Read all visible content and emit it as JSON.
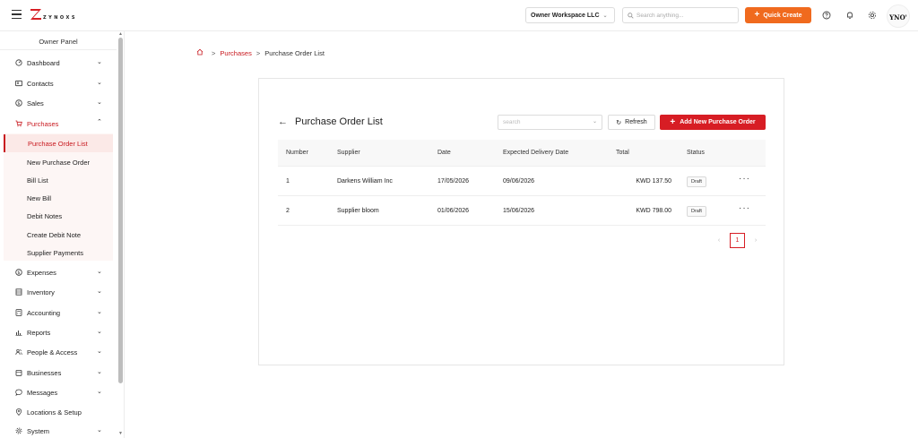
{
  "app": {
    "logo_text": "ZYNOXS",
    "brand_color": "#d71d24",
    "accent_color": "#f06a1e"
  },
  "topbar": {
    "workspace": "Owner Workspace LLC",
    "search_placeholder": "Search anything...",
    "quick_create": "Quick Create",
    "avatar_text": "YNO'"
  },
  "sidebar": {
    "panel_title": "Owner Panel",
    "items": [
      {
        "label": "Dashboard",
        "icon": "dashboard-icon"
      },
      {
        "label": "Contacts",
        "icon": "contacts-icon"
      },
      {
        "label": "Sales",
        "icon": "dollar-icon"
      },
      {
        "label": "Purchases",
        "icon": "cart-icon",
        "expanded": true
      },
      {
        "label": "Expenses",
        "icon": "dollar-icon"
      },
      {
        "label": "Inventory",
        "icon": "inventory-icon"
      },
      {
        "label": "Accounting",
        "icon": "calculator-icon"
      },
      {
        "label": "Reports",
        "icon": "bar-chart-icon"
      },
      {
        "label": "People & Access",
        "icon": "people-icon"
      },
      {
        "label": "Businesses",
        "icon": "building-icon"
      },
      {
        "label": "Messages",
        "icon": "chat-icon"
      },
      {
        "label": "Locations & Setup",
        "icon": "location-icon"
      },
      {
        "label": "System",
        "icon": "gear-icon"
      }
    ],
    "purchases_sub": [
      "Purchase Order List",
      "New Purchase Order",
      "Bill List",
      "New Bill",
      "Debit Notes",
      "Create Debit Note",
      "Supplier Payments"
    ]
  },
  "breadcrumb": {
    "sep": ">",
    "parent": "Purchases",
    "current": "Purchase Order List"
  },
  "card": {
    "title": "Purchase Order List",
    "search_placeholder": "search",
    "refresh_label": "Refresh",
    "add_label": "Add New Purchase Order"
  },
  "table": {
    "columns": [
      "Number",
      "Supplier",
      "Date",
      "Expected Delivery Date",
      "Total",
      "Status"
    ],
    "rows": [
      {
        "number": "1",
        "supplier": "Darkens William Inc",
        "date": "17/05/2026",
        "expected": "09/06/2026",
        "total": "KWD 137.50",
        "status": "Draft"
      },
      {
        "number": "2",
        "supplier": "Supplier bloom",
        "date": "01/06/2026",
        "expected": "15/06/2026",
        "total": "KWD 798.00",
        "status": "Draft"
      }
    ],
    "row_menu": "···"
  },
  "pagination": {
    "current_page": "1"
  }
}
